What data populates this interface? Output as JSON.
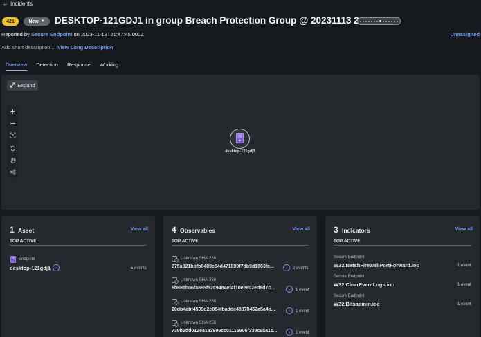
{
  "breadcrumb": {
    "back_label": "Incidents"
  },
  "incident": {
    "number": "421",
    "status": "New",
    "title": "DESKTOP-121GDJ1 in group Breach Protection Group @ 20231113 21:47:45",
    "reported_by_prefix": "Reported by",
    "reporter": "Secure Endpoint",
    "reported_on_prefix": "on",
    "reported_at": "2023-11-13T21:47:45.000Z",
    "assignee": "Unassigned",
    "short_desc_placeholder": "Add short description...",
    "long_desc_link": "View Long Description",
    "progress_step": 7,
    "progress_steps": 14
  },
  "tabs": [
    {
      "label": "Overview",
      "active": true
    },
    {
      "label": "Detection",
      "active": false
    },
    {
      "label": "Response",
      "active": false
    },
    {
      "label": "Worklog",
      "active": false
    }
  ],
  "graph": {
    "expand_label": "Expand",
    "tools": [
      "zoom-in-icon",
      "zoom-out-icon",
      "fit-view-icon",
      "reset-icon",
      "pan-hand-icon",
      "layout-icon"
    ],
    "node_label": "desktop-121gdj1",
    "node_icon": "computer-icon"
  },
  "cards": {
    "assets": {
      "count": "1",
      "title": "Asset",
      "view_all": "View all",
      "top_active": "TOP ACTIVE",
      "items": [
        {
          "type": "Endpoint",
          "name": "desktop-121gdj1",
          "events": "5 events"
        }
      ]
    },
    "observables": {
      "count": "4",
      "title": "Observables",
      "view_all": "View all",
      "top_active": "TOP ACTIVE",
      "items": [
        {
          "type": "Unknown SHA-256",
          "name": "275a021bbfb6489e54d471899f7db9d1663fc...",
          "events": "2 events"
        },
        {
          "type": "Unknown SHA-256",
          "name": "6b691b06fa865f52c9484ef4f10e2e02ed6d7c...",
          "events": "1 event"
        },
        {
          "type": "Unknown SHA-256",
          "name": "20db4abf4539d2e054fbadde48078452a5a4a...",
          "events": "1 event"
        },
        {
          "type": "Unknown SHA-256",
          "name": "739b2dd012ea183895cc01116906f339c9aa1c...",
          "events": "1 event"
        }
      ]
    },
    "indicators": {
      "count": "3",
      "title": "Indicators",
      "view_all": "View all",
      "top_active": "TOP ACTIVE",
      "items": [
        {
          "type": "Secure Endpoint",
          "name": "W32.NetshFirewallPortForward.ioc",
          "events": "1 event"
        },
        {
          "type": "Secure Endpoint",
          "name": "W32.ClearEventLogs.ioc",
          "events": "1 event"
        },
        {
          "type": "Secure Endpoint",
          "name": "W32.Bitsadmin.ioc",
          "events": "1 event"
        }
      ]
    }
  },
  "colors": {
    "badge": "#f1c232",
    "link": "#6f9ef0",
    "bg": "#16191d",
    "panel": "#25282d"
  }
}
